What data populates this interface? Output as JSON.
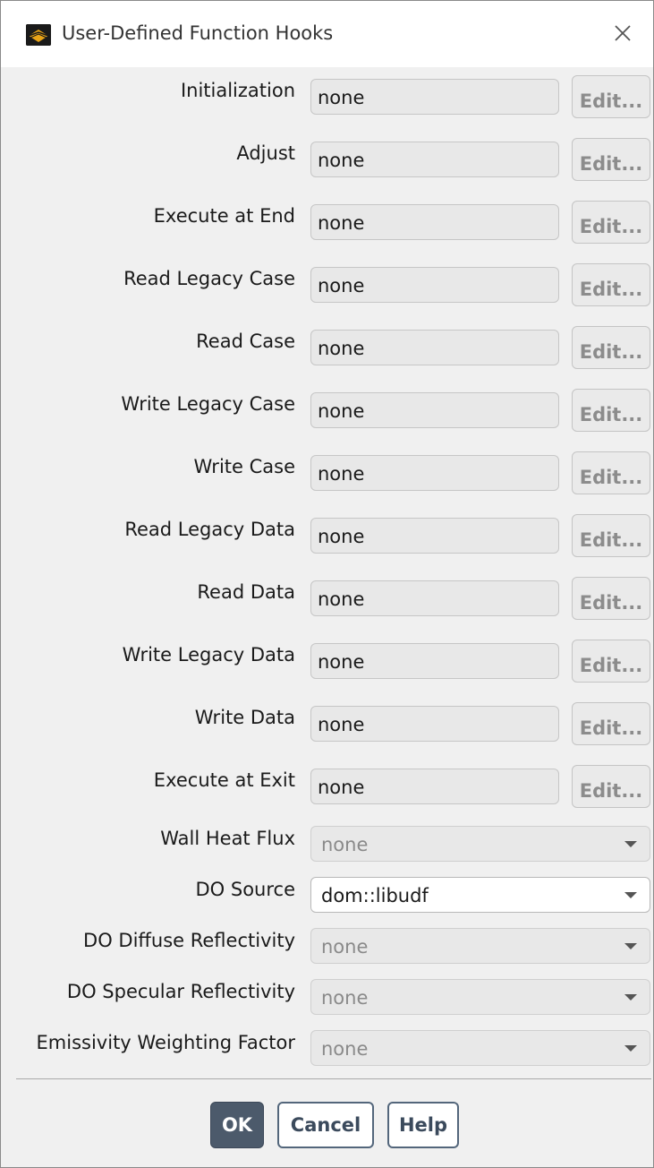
{
  "window": {
    "title": "User-Defined Function Hooks"
  },
  "hooks": [
    {
      "label": "Initialization",
      "value": "none",
      "edit_label": "Edit..."
    },
    {
      "label": "Adjust",
      "value": "none",
      "edit_label": "Edit..."
    },
    {
      "label": "Execute at End",
      "value": "none",
      "edit_label": "Edit..."
    },
    {
      "label": "Read Legacy Case",
      "value": "none",
      "edit_label": "Edit..."
    },
    {
      "label": "Read Case",
      "value": "none",
      "edit_label": "Edit..."
    },
    {
      "label": "Write Legacy Case",
      "value": "none",
      "edit_label": "Edit..."
    },
    {
      "label": "Write Case",
      "value": "none",
      "edit_label": "Edit..."
    },
    {
      "label": "Read Legacy Data",
      "value": "none",
      "edit_label": "Edit..."
    },
    {
      "label": "Read Data",
      "value": "none",
      "edit_label": "Edit..."
    },
    {
      "label": "Write Legacy Data",
      "value": "none",
      "edit_label": "Edit..."
    },
    {
      "label": "Write Data",
      "value": "none",
      "edit_label": "Edit..."
    },
    {
      "label": "Execute at Exit",
      "value": "none",
      "edit_label": "Edit..."
    }
  ],
  "dropdowns": [
    {
      "label": "Wall Heat Flux",
      "value": "none",
      "enabled": false
    },
    {
      "label": "DO Source",
      "value": "dom::libudf",
      "enabled": true
    },
    {
      "label": "DO Diffuse Reflectivity",
      "value": "none",
      "enabled": false
    },
    {
      "label": "DO Specular Reflectivity",
      "value": "none",
      "enabled": false
    },
    {
      "label": "Emissivity Weighting Factor",
      "value": "none",
      "enabled": false
    }
  ],
  "buttons": {
    "ok": "OK",
    "cancel": "Cancel",
    "help": "Help"
  }
}
